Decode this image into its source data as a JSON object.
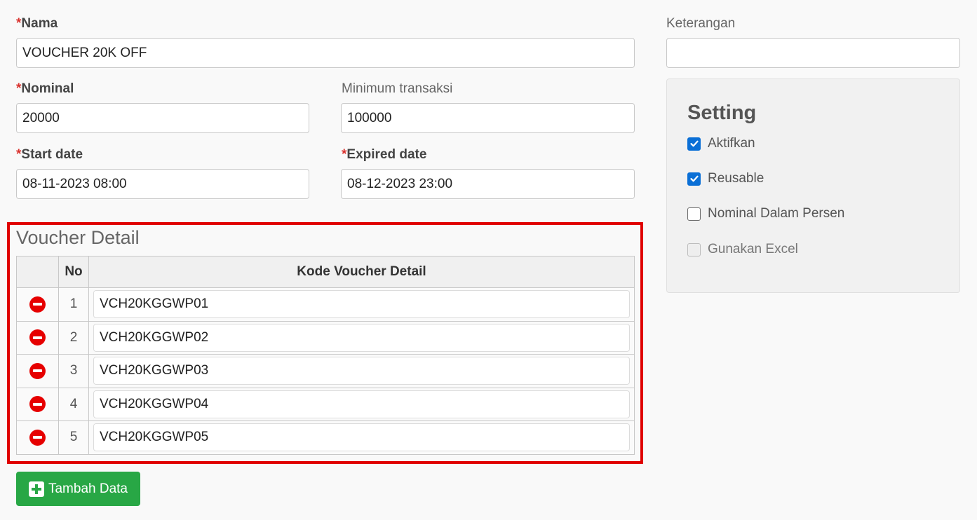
{
  "form": {
    "nama": {
      "label": "Nama",
      "value": "VOUCHER 20K OFF"
    },
    "keterangan": {
      "label": "Keterangan",
      "value": ""
    },
    "nominal": {
      "label": "Nominal",
      "value": "20000"
    },
    "minimum": {
      "label": "Minimum transaksi",
      "value": "100000"
    },
    "start_date": {
      "label": "Start date",
      "value": "08-11-2023 08:00"
    },
    "expired_date": {
      "label": "Expired date",
      "value": "08-12-2023 23:00"
    },
    "required_mark": "*"
  },
  "setting": {
    "title": "Setting",
    "options": [
      {
        "label": "Aktifkan",
        "checked": true,
        "disabled": false
      },
      {
        "label": "Reusable",
        "checked": true,
        "disabled": false
      },
      {
        "label": "Nominal Dalam Persen",
        "checked": false,
        "disabled": false
      },
      {
        "label": "Gunakan Excel",
        "checked": false,
        "disabled": true
      }
    ]
  },
  "voucher_detail": {
    "title": "Voucher Detail",
    "columns": [
      "",
      "No",
      "Kode Voucher Detail"
    ],
    "rows": [
      {
        "no": "1",
        "code": "VCH20KGGWP01",
        "icon": "remove-icon"
      },
      {
        "no": "2",
        "code": "VCH20KGGWP02",
        "icon": "remove-icon"
      },
      {
        "no": "3",
        "code": "VCH20KGGWP03",
        "icon": "remove-icon"
      },
      {
        "no": "4",
        "code": "VCH20KGGWP04",
        "icon": "remove-icon"
      },
      {
        "no": "5",
        "code": "VCH20KGGWP05",
        "icon": "remove-icon"
      }
    ]
  },
  "actions": {
    "add_label": "Tambah Data",
    "add_icon": "plus-square-icon"
  },
  "colors": {
    "required": "#d9302c",
    "highlight_border": "#e00000",
    "add_button": "#28a745",
    "remove_icon": "#e60000",
    "checkbox": "#0a6fd6"
  }
}
